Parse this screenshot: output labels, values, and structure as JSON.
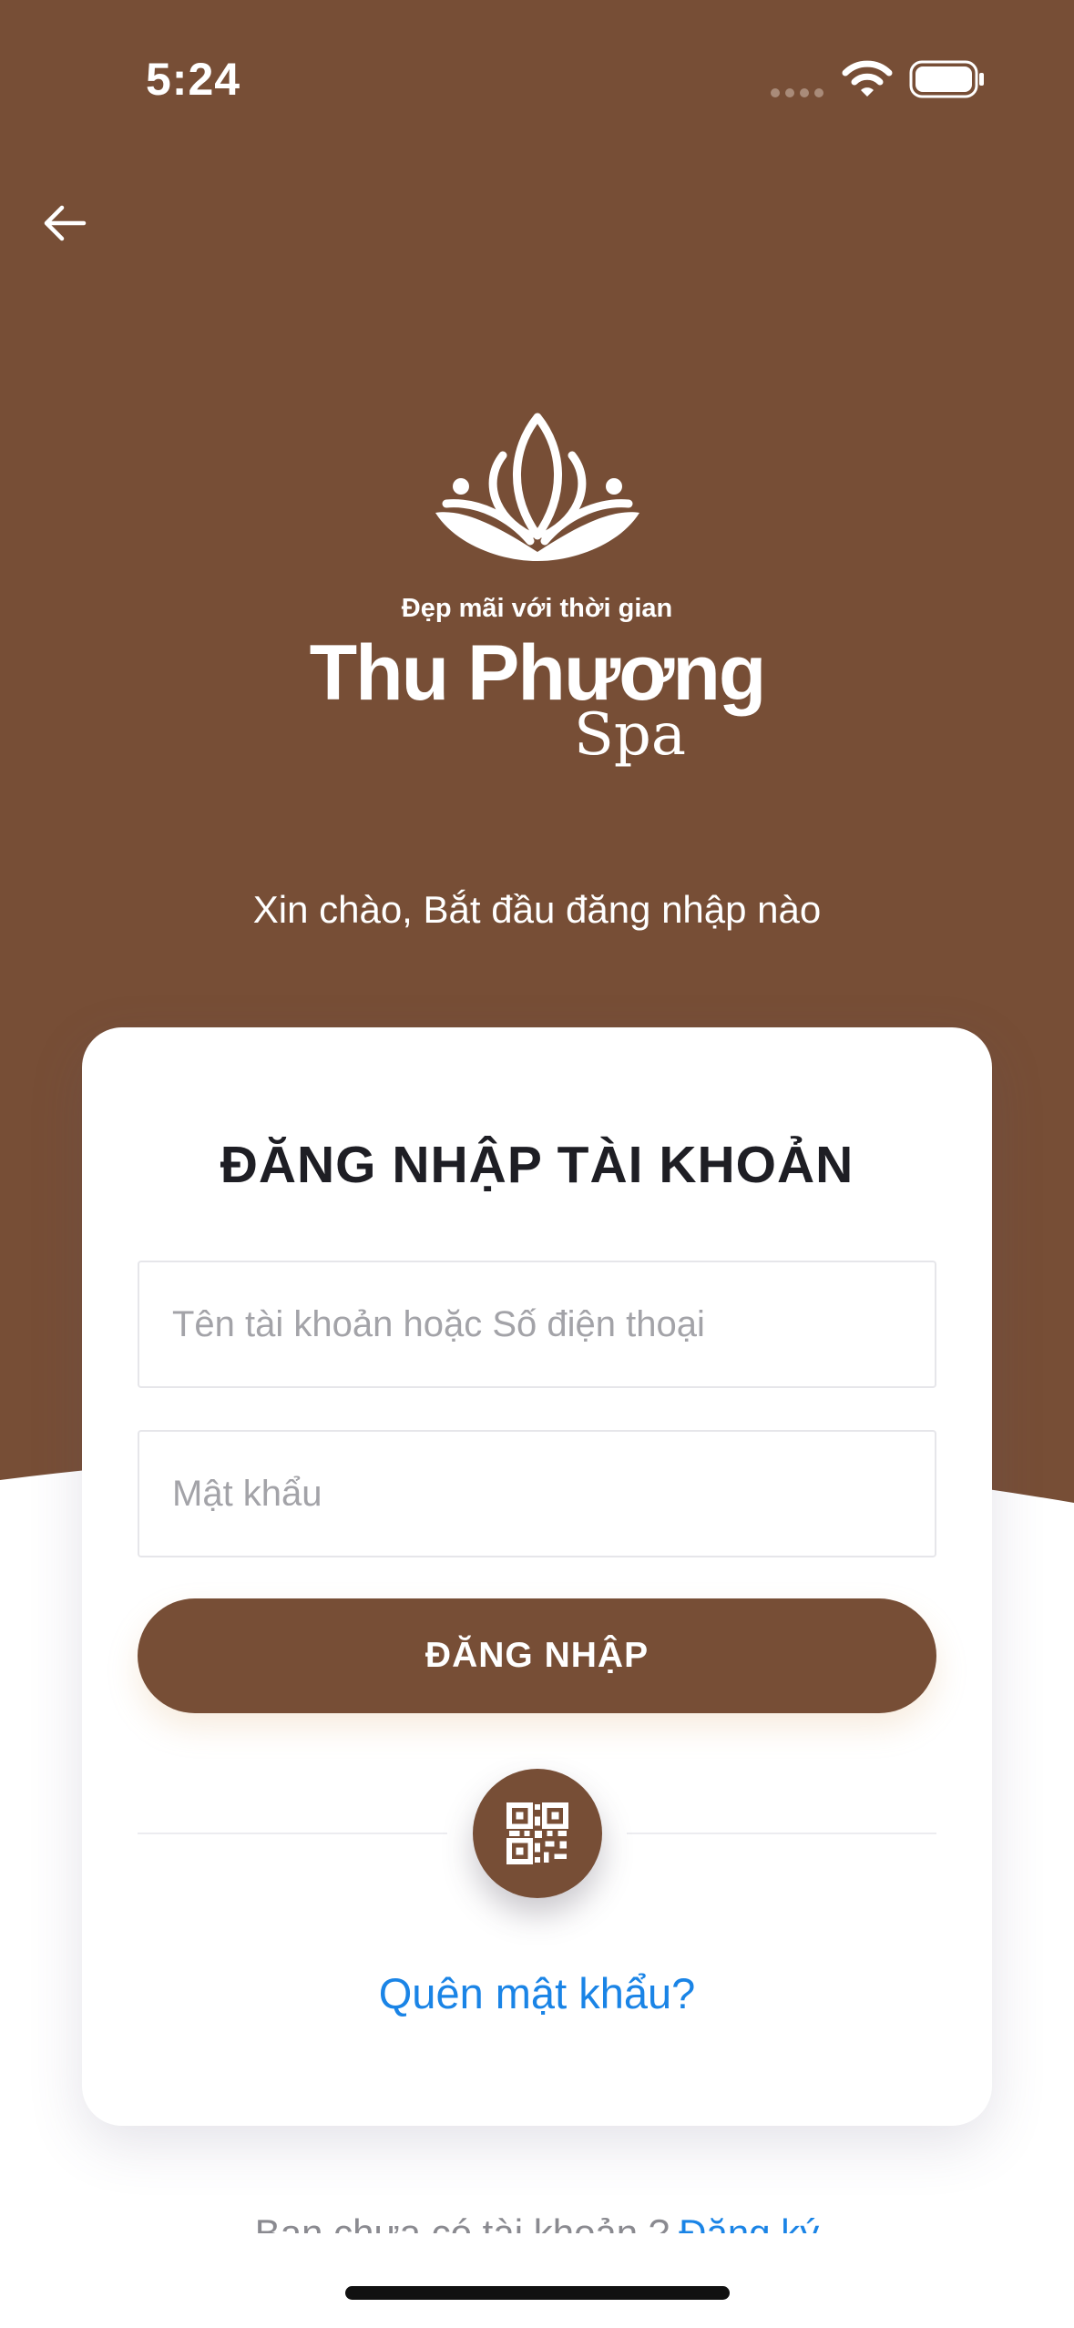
{
  "status_bar": {
    "time": "5:24"
  },
  "brand": {
    "tagline": "Đẹp mãi với thời gian",
    "name": "Thu Phương",
    "suffix": "Spa"
  },
  "greeting": "Xin chào, Bắt đầu đăng nhập nào",
  "login_card": {
    "title": "ĐĂNG NHẬP TÀI KHOẢN",
    "username": {
      "value": "",
      "placeholder": "Tên tài khoản hoặc Số điện thoại"
    },
    "password": {
      "value": "",
      "placeholder": "Mật khẩu"
    },
    "login_label": "ĐĂNG NHẬP",
    "qr_icon": "qr-code-icon",
    "forgot_password": "Quên mật khẩu?"
  },
  "signup": {
    "prompt": "Bạn chưa có tài khoản ?",
    "link": "Đăng ký"
  },
  "icons": {
    "back": "arrow-left-icon",
    "wifi": "wifi-icon",
    "battery": "battery-icon"
  },
  "colors": {
    "brand_brown": "#774e36",
    "link_blue": "#1a84e6",
    "title_text": "#1e1e24"
  }
}
